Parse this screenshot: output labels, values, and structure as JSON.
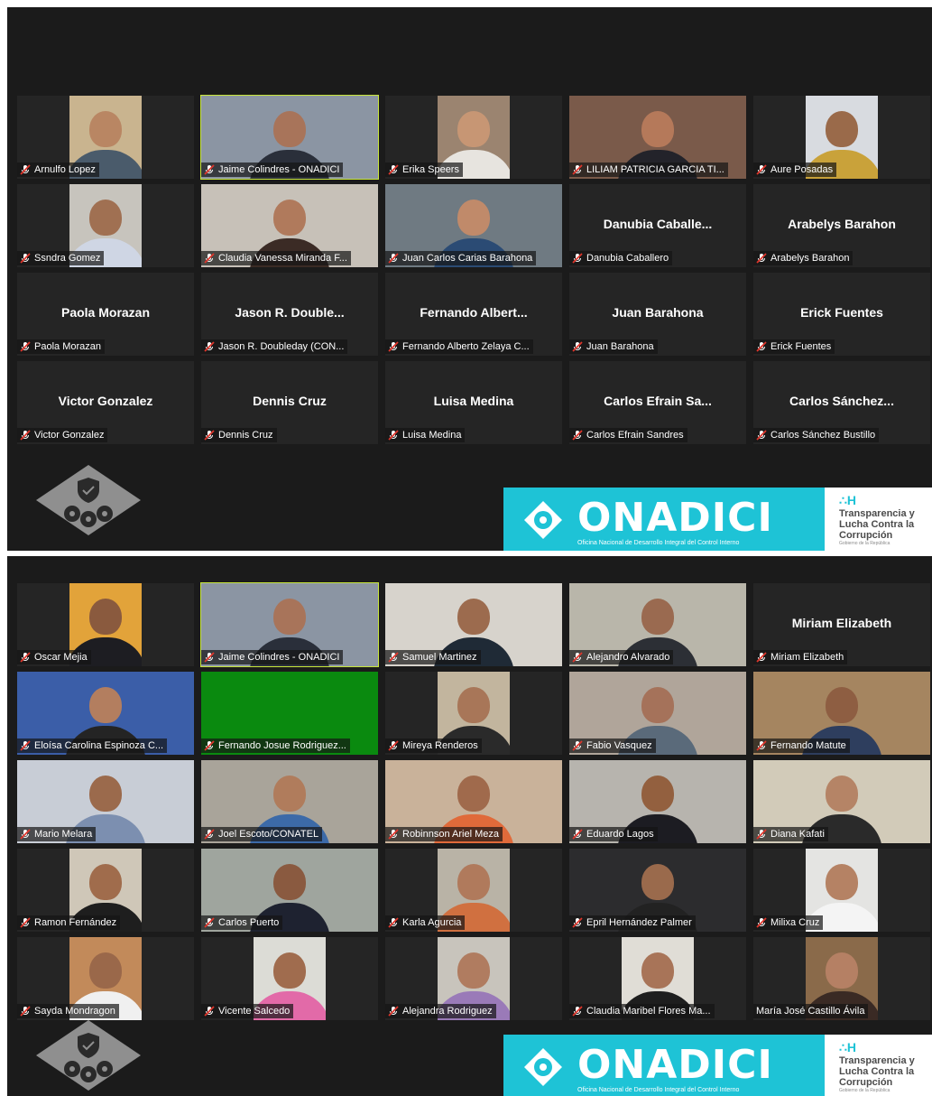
{
  "top_panel": {
    "participants": [
      {
        "name": "Arnulfo Lopez",
        "video": true,
        "bg": "#c9b48f",
        "skin": "#b98663",
        "shirt": "#4a5b6b",
        "width": "narrow"
      },
      {
        "name": "Jaime Colindres - ONADICI",
        "video": true,
        "active": true,
        "bg": "#8b95a3",
        "skin": "#a8745a",
        "shirt": "#2a2f3a",
        "width": "full"
      },
      {
        "name": "Erika Speers",
        "video": true,
        "bg": "#9b8470",
        "skin": "#c79674",
        "shirt": "#e7e4df",
        "width": "narrow"
      },
      {
        "name": "LILIAM PATRICIA GARCIA TI...",
        "video": true,
        "bg": "#7a5a4a",
        "skin": "#b5795a",
        "shirt": "#23232a",
        "width": "full"
      },
      {
        "name": "Aure Posadas",
        "video": true,
        "bg": "#d8dbe0",
        "skin": "#9a6a4a",
        "shirt": "#c9a23a",
        "width": "narrow"
      },
      {
        "name": "Ssndra Gomez",
        "video": true,
        "bg": "#c7c4bd",
        "skin": "#a07052",
        "shirt": "#cfd6e4",
        "width": "narrow"
      },
      {
        "name": "Claudia Vanessa Miranda F...",
        "video": true,
        "bg": "#c7c1b8",
        "skin": "#b07a5c",
        "shirt": "#3b2b25",
        "width": "full"
      },
      {
        "name": "Juan Carlos Carias Barahona",
        "video": true,
        "bg": "#6f7a82",
        "skin": "#c08a6a",
        "shirt": "#2b4b74",
        "width": "full"
      },
      {
        "name": "Danubia Caballero",
        "video": false,
        "display": "Danubia  Caballe..."
      },
      {
        "name": "Arabelys Barahon",
        "video": false,
        "display": "Arabelys Barahon"
      },
      {
        "name": "Paola Morazan",
        "video": false,
        "display": "Paola Morazan"
      },
      {
        "name": "Jason R. Doubleday (CON...",
        "video": false,
        "display": "Jason  R.  Double..."
      },
      {
        "name": "Fernando Alberto Zelaya C...",
        "video": false,
        "display": "Fernando  Albert..."
      },
      {
        "name": "Juan Barahona",
        "video": false,
        "display": "Juan Barahona"
      },
      {
        "name": "Erick Fuentes",
        "video": false,
        "display": "Erick Fuentes"
      },
      {
        "name": "Victor Gonzalez",
        "video": false,
        "display": "Victor Gonzalez"
      },
      {
        "name": "Dennis Cruz",
        "video": false,
        "display": "Dennis Cruz"
      },
      {
        "name": "Luisa Medina",
        "video": false,
        "display": "Luisa Medina"
      },
      {
        "name": "Carlos Efrain Sandres",
        "video": false,
        "display": "Carlos  Efrain  Sa..."
      },
      {
        "name": "Carlos Sánchez Bustillo",
        "video": false,
        "display": "Carlos  Sánchez..."
      }
    ]
  },
  "bottom_panel": {
    "participants": [
      {
        "name": "Oscar Mejia",
        "video": true,
        "bg": "#e2a33a",
        "skin": "#8a5a3e",
        "shirt": "#1d1d22",
        "width": "narrow"
      },
      {
        "name": "Jaime Colindres - ONADICI",
        "video": true,
        "active": true,
        "bg": "#8b95a3",
        "skin": "#a8745a",
        "shirt": "#2a2f3a",
        "width": "full"
      },
      {
        "name": "Samuel Martinez",
        "video": true,
        "bg": "#d7d3cc",
        "skin": "#9c6b4e",
        "shirt": "#1f2a36",
        "width": "full"
      },
      {
        "name": "Alejandro Alvarado",
        "video": true,
        "bg": "#b9b6aa",
        "skin": "#9a6a50",
        "shirt": "#2c2f35",
        "width": "full"
      },
      {
        "name": "Miriam Elizabeth",
        "video": false,
        "display": "Miriam Elizabeth"
      },
      {
        "name": "Eloísa Carolina Espinoza C...",
        "video": true,
        "bg": "#3b5ea8",
        "skin": "#b37e5f",
        "shirt": "#242424",
        "width": "full"
      },
      {
        "name": "Fernando Josue Rodriguez...",
        "video": true,
        "green": true,
        "width": "full"
      },
      {
        "name": "Mireya Renderos",
        "video": true,
        "bg": "#c2b59e",
        "skin": "#a87658",
        "shirt": "#2a2a2a",
        "width": "narrow"
      },
      {
        "name": "Fabio Vasquez",
        "video": true,
        "bg": "#b0a59a",
        "skin": "#a5725a",
        "shirt": "#5a6a7a",
        "width": "full"
      },
      {
        "name": "Fernando Matute",
        "video": true,
        "bg": "#a58560",
        "skin": "#8e5e42",
        "shirt": "#2e3e5e",
        "width": "full"
      },
      {
        "name": "Mario Melara",
        "video": true,
        "bg": "#c8cdd6",
        "skin": "#9b6a4c",
        "shirt": "#7c8fb0",
        "width": "full"
      },
      {
        "name": "Joel Escoto/CONATEL",
        "video": true,
        "bg": "#a9a49a",
        "skin": "#b07c5c",
        "shirt": "#3c6aa8",
        "width": "full"
      },
      {
        "name": "Robinnson Ariel Meza",
        "video": true,
        "bg": "#c9b29a",
        "skin": "#a06a4c",
        "shirt": "#e06a3a",
        "width": "full"
      },
      {
        "name": "Eduardo Lagos",
        "video": true,
        "bg": "#b7b4ae",
        "skin": "#93603f",
        "shirt": "#1c1c22",
        "width": "full"
      },
      {
        "name": "Diana Kafati",
        "video": true,
        "bg": "#d2cbb9",
        "skin": "#b58466",
        "shirt": "#2a2a2a",
        "width": "full"
      },
      {
        "name": "Ramon Fernández",
        "video": true,
        "bg": "#cfc7b8",
        "skin": "#a06c4c",
        "shirt": "#1e1e1e",
        "width": "narrow"
      },
      {
        "name": "Carlos Puerto",
        "video": true,
        "bg": "#9fa59e",
        "skin": "#8a5a40",
        "shirt": "#1e2230",
        "width": "full"
      },
      {
        "name": "Karla Agurcia",
        "video": true,
        "bg": "#b9b3a6",
        "skin": "#b07a5c",
        "shirt": "#d07040",
        "width": "narrow"
      },
      {
        "name": "Epril Hernández Palmer",
        "video": true,
        "bg": "#2c2c2e",
        "skin": "#9a6a4c",
        "shirt": "#222",
        "width": "full"
      },
      {
        "name": "Milixa Cruz",
        "video": true,
        "bg": "#e4e4e2",
        "skin": "#b58264",
        "shirt": "#f4f4f4",
        "width": "narrow"
      },
      {
        "name": "Sayda Mondragon",
        "video": true,
        "bg": "#c28a5a",
        "skin": "#9a684a",
        "shirt": "#f0f0f0",
        "width": "narrow"
      },
      {
        "name": "Vicente Salcedo",
        "video": true,
        "bg": "#dcdcd6",
        "skin": "#a06c4e",
        "shirt": "#e26aa8",
        "width": "narrow"
      },
      {
        "name": "Alejandra Rodriguez",
        "video": true,
        "bg": "#c8c4bc",
        "skin": "#b07c60",
        "shirt": "#9a7ab8",
        "width": "narrow"
      },
      {
        "name": "Claudia Maribel Flores Ma...",
        "video": true,
        "bg": "#e0ddd6",
        "skin": "#a87458",
        "shirt": "#1e1e1e",
        "width": "narrow"
      },
      {
        "name": "María José Castillo Ávila",
        "video": true,
        "bg": "#8a6a4a",
        "skin": "#b58064",
        "shirt": "#3a2a24",
        "width": "narrow",
        "no_mic": true
      }
    ]
  },
  "branding": {
    "word": "ONADICI",
    "subtitle": "Oficina Nacional de Desarrollo Integral del Control Interno",
    "tagline_icon": "∴H",
    "tagline_lines": [
      "Transparencia y",
      "Lucha Contra la",
      "Corrupción"
    ],
    "tagline_small": "Gobierno de la República",
    "brand_color": "#1ec3d6"
  },
  "icons": {
    "muted": "muted-mic-icon",
    "emblem": "shield-gears-emblem-icon"
  }
}
